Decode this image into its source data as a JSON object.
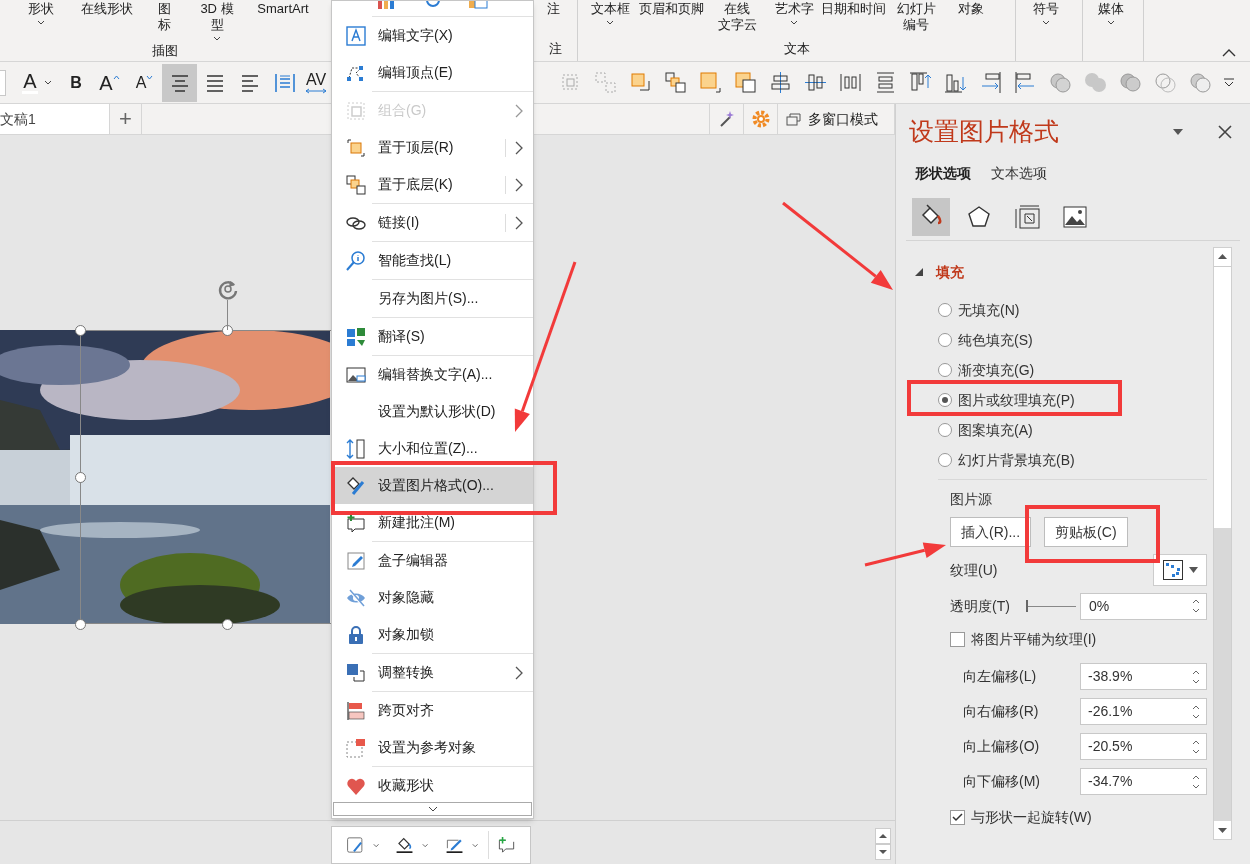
{
  "ribbon": {
    "groups": [
      {
        "label": "插图",
        "buttons": [
          {
            "lines": [
              "形状"
            ],
            "dropdown": true
          },
          {
            "lines": [
              "在线形状"
            ],
            "dropdown": false
          },
          {
            "lines": [
              "图",
              "标"
            ],
            "dropdown": false
          },
          {
            "lines": [
              "3D 模",
              "型"
            ],
            "dropdown": true
          },
          {
            "lines": [
              "SmartArt"
            ],
            "dropdown": false
          }
        ]
      },
      {
        "label": "注",
        "buttons": [
          {
            "lines": [
              "注"
            ],
            "dropdown": false
          }
        ]
      },
      {
        "label": "文本",
        "buttons": [
          {
            "lines": [
              "文本框"
            ],
            "dropdown": true
          },
          {
            "lines": [
              "页眉和页脚"
            ],
            "dropdown": false
          },
          {
            "lines": [
              "在线",
              "文字云"
            ],
            "dropdown": false
          },
          {
            "lines": [
              "艺术字"
            ],
            "dropdown": true
          },
          {
            "lines": [
              "日期和时间"
            ],
            "dropdown": false
          },
          {
            "lines": [
              "幻灯片",
              "编号"
            ],
            "dropdown": false
          },
          {
            "lines": [
              "对象"
            ],
            "dropdown": false
          }
        ]
      },
      {
        "buttons": [
          {
            "lines": [
              "符号"
            ],
            "dropdown": true
          }
        ]
      },
      {
        "buttons": [
          {
            "lines": [
              "媒体"
            ],
            "dropdown": true
          }
        ]
      }
    ]
  },
  "text_toolbar": [
    {
      "glyph": "A",
      "selected": false
    },
    {
      "glyph": "B",
      "selected": false
    },
    {
      "glyph": "A",
      "selected": false
    },
    {
      "glyph": "A",
      "selected": false
    },
    {
      "selected": true
    },
    {
      "selected": false
    },
    {
      "selected": false
    },
    {
      "selected": false
    },
    {
      "glyph": "AV",
      "selected": false
    }
  ],
  "document_tab": {
    "label": "文稿1",
    "add": "+"
  },
  "window_mode_button": "多窗口模式",
  "context_menu": {
    "groups": [
      [
        {
          "label": "编辑文字(X)",
          "submenu": false,
          "split": false,
          "disabled": false,
          "selected": false
        },
        {
          "label": "编辑顶点(E)",
          "submenu": false,
          "split": false,
          "disabled": false,
          "selected": false
        }
      ],
      [
        {
          "label": "组合(G)",
          "submenu": true,
          "split": false,
          "disabled": true,
          "selected": false
        },
        {
          "label": "置于顶层(R)",
          "submenu": true,
          "split": true,
          "disabled": false,
          "selected": false
        },
        {
          "label": "置于底层(K)",
          "submenu": true,
          "split": true,
          "disabled": false,
          "selected": false
        }
      ],
      [
        {
          "label": "链接(I)",
          "submenu": true,
          "split": true,
          "disabled": false,
          "selected": false
        }
      ],
      [
        {
          "label": "智能查找(L)",
          "submenu": false,
          "split": false,
          "disabled": false,
          "selected": false
        }
      ],
      [
        {
          "label": "另存为图片(S)...",
          "submenu": false,
          "split": false,
          "disabled": false,
          "selected": false
        }
      ],
      [
        {
          "label": "翻译(S)",
          "submenu": false,
          "split": false,
          "disabled": false,
          "selected": false
        }
      ],
      [
        {
          "label": "编辑替换文字(A)...",
          "submenu": false,
          "split": false,
          "disabled": false,
          "selected": false
        },
        {
          "label": "设置为默认形状(D)",
          "submenu": false,
          "split": false,
          "disabled": false,
          "selected": false
        },
        {
          "label": "大小和位置(Z)...",
          "submenu": false,
          "split": false,
          "disabled": false,
          "selected": false
        },
        {
          "label": "设置图片格式(O)...",
          "submenu": false,
          "split": false,
          "disabled": false,
          "selected": true
        },
        {
          "label": "新建批注(M)",
          "submenu": false,
          "split": false,
          "disabled": false,
          "selected": false
        }
      ],
      [
        {
          "label": "盒子编辑器",
          "submenu": false,
          "split": false,
          "disabled": false,
          "selected": false
        },
        {
          "label": "对象隐藏",
          "submenu": false,
          "split": false,
          "disabled": false,
          "selected": false
        },
        {
          "label": "对象加锁",
          "submenu": false,
          "split": false,
          "disabled": false,
          "selected": false
        }
      ],
      [
        {
          "label": "调整转换",
          "submenu": true,
          "split": false,
          "disabled": false,
          "selected": false
        }
      ],
      [
        {
          "label": "跨页对齐",
          "submenu": false,
          "split": false,
          "disabled": false,
          "selected": false
        },
        {
          "label": "设置为参考对象",
          "submenu": false,
          "split": false,
          "disabled": false,
          "selected": false
        }
      ],
      [
        {
          "label": "收藏形状",
          "submenu": false,
          "split": false,
          "disabled": false,
          "selected": false
        }
      ]
    ]
  },
  "format_pane": {
    "title": "设置图片格式",
    "tabs": [
      {
        "label": "形状选项",
        "selected": true
      },
      {
        "label": "文本选项",
        "selected": false
      }
    ],
    "icon_tabs": [
      {
        "selected": true
      },
      {
        "selected": false
      },
      {
        "selected": false
      },
      {
        "selected": false
      }
    ],
    "section": {
      "title": "填充",
      "expanded": true
    },
    "fill_options": [
      {
        "label": "无填充(N)",
        "selected": false
      },
      {
        "label": "纯色填充(S)",
        "selected": false
      },
      {
        "label": "渐变填充(G)",
        "selected": false
      },
      {
        "label": "图片或纹理填充(P)",
        "selected": true
      },
      {
        "label": "图案填充(A)",
        "selected": false
      },
      {
        "label": "幻灯片背景填充(B)",
        "selected": false
      }
    ],
    "picture_source": {
      "label": "图片源",
      "buttons": [
        "插入(R)...",
        "剪贴板(C)"
      ]
    },
    "texture": {
      "label": "纹理(U)"
    },
    "transparency": {
      "label": "透明度(T)",
      "level": 0,
      "value": "0%"
    },
    "tile_checkbox": {
      "label": "将图片平铺为纹理(I)",
      "checked": false
    },
    "offsets": [
      {
        "label": "向左偏移(L)",
        "value": "-38.9%"
      },
      {
        "label": "向右偏移(R)",
        "value": "-26.1%"
      },
      {
        "label": "向上偏移(O)",
        "value": "-20.5%"
      },
      {
        "label": "向下偏移(M)",
        "value": "-34.7%"
      }
    ],
    "rotate_checkbox": {
      "label": "与形状一起旋转(W)",
      "checked": true
    }
  },
  "annotations": [
    {
      "kind": "box"
    },
    {
      "kind": "box"
    },
    {
      "kind": "box"
    },
    {
      "kind": "arrow"
    },
    {
      "kind": "arrow"
    },
    {
      "kind": "arrow"
    }
  ]
}
